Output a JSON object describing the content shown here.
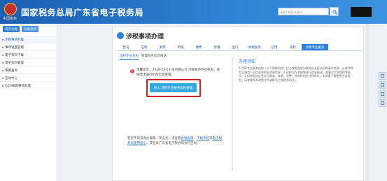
{
  "header": {
    "site_title": "国家税务总局广东省电子税务局",
    "emblem_caption": "中国税务",
    "search_placeholder": "请输入搜索关键词",
    "search_icon": "search-icon"
  },
  "sidebar": {
    "tabs": [
      "首页功能",
      "功能菜单"
    ],
    "items": [
      {
        "label": "涉税事项办理",
        "active": true
      },
      {
        "label": "事项进度管理",
        "active": false
      },
      {
        "label": "电子资料下载",
        "active": false
      },
      {
        "label": "电子资料管理",
        "active": false
      },
      {
        "label": "我要查询",
        "active": false
      },
      {
        "label": "互动中心",
        "active": false
      },
      {
        "label": "O2O邮寄事项办理",
        "active": false
      }
    ]
  },
  "main": {
    "page_title": "涉税事项办理",
    "nav": [
      {
        "label": "登记",
        "active": false
      },
      {
        "label": "证明",
        "active": false
      },
      {
        "label": "发票",
        "active": false
      },
      {
        "label": "申报",
        "active": false
      },
      {
        "label": "缴费",
        "active": false
      },
      {
        "label": "优惠",
        "active": false
      },
      {
        "label": "出口",
        "active": false
      },
      {
        "label": "纳税服务",
        "active": false
      },
      {
        "label": "信用",
        "active": false
      },
      {
        "label": "法制",
        "active": false
      },
      {
        "label": "涉税专业服务",
        "active": true
      }
    ],
    "subtabs": [
      {
        "label": "涉税专业机构",
        "active": true
      },
      {
        "label": "管理服务信息报送",
        "active": false
      }
    ],
    "notice_icon": "exclamation-icon",
    "notice": "温馨提示：2019-02-19 成功确认为 涉税服务专业机构，请按需求进行机构信息管理。",
    "action_button": "进入 涉税专业服务机构管理",
    "bottom_intro": "若您不知道要办理哪一项业务，请查看",
    "bottom_link1": "办税指南",
    "bottom_sep": "、",
    "bottom_link2": "下载专区",
    "bottom_mid": "或",
    "bottom_link3": "电子税务局使用指引",
    "bottom_end": "，或登录广东省电子税务局进行咨询。",
    "panel_title": "办理须知",
    "panel_text": "1.涉税专业服务机构（以下简称机构）应当按照规定向税务机关报送机构基本信息、从事涉税专业服务人员信息和职业资格信息；2.机构可在本模块进行信息报送、变更及实名管理等事项；3.机构报送信息应当真实、准确、完整，并承担相应法律责任；4.如需了解更多业务规定，请查看相关政策文件或联系主管税务机关。"
  },
  "colors": {
    "header_blue": "#1a5fb4",
    "accent": "#2f7ed8",
    "button": "#35a8e0",
    "highlight": "#c9232b"
  }
}
